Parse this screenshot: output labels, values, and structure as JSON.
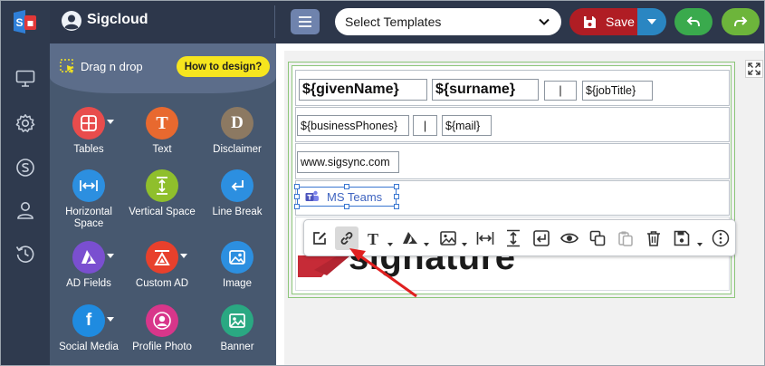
{
  "app": {
    "name": "Sigcloud"
  },
  "header": {
    "template_select": {
      "value": "Select Templates"
    },
    "save_label": "Save"
  },
  "panel": {
    "title": "Drag n drop",
    "help_button": "How to design?",
    "tools": [
      {
        "key": "tables",
        "label": "Tables",
        "color": "#e84c4c",
        "icon": "table-icon",
        "caret": true
      },
      {
        "key": "text",
        "label": "Text",
        "color": "#e8692f",
        "icon": "text-icon",
        "glyph": "T"
      },
      {
        "key": "disclaimer",
        "label": "Disclaimer",
        "color": "#8c7962",
        "icon": "disclaimer-icon",
        "glyph": "D"
      },
      {
        "key": "horizontal-space",
        "label": "Horizontal Space",
        "color": "#2c8fe0",
        "icon": "horizontal-space-icon"
      },
      {
        "key": "vertical-space",
        "label": "Vertical Space",
        "color": "#8fbf2c",
        "icon": "vertical-space-icon"
      },
      {
        "key": "line-break",
        "label": "Line Break",
        "color": "#2c8fe0",
        "icon": "line-break-icon"
      },
      {
        "key": "ad-fields",
        "label": "AD Fields",
        "color": "#7a4fd0",
        "icon": "azure-icon",
        "caret": true
      },
      {
        "key": "custom-ad",
        "label": "Custom AD",
        "color": "#e8402c",
        "icon": "custom-ad-icon",
        "caret": true
      },
      {
        "key": "image",
        "label": "Image",
        "color": "#2c8fe0",
        "icon": "image-icon"
      },
      {
        "key": "social-media",
        "label": "Social Media",
        "color": "#1f8be0",
        "icon": "facebook-icon",
        "glyph": "f",
        "caret": true
      },
      {
        "key": "profile-photo",
        "label": "Profile Photo",
        "color": "#d8368a",
        "icon": "profile-photo-icon"
      },
      {
        "key": "banner",
        "label": "Banner",
        "color": "#2aa882",
        "icon": "banner-icon"
      }
    ]
  },
  "signature": {
    "given_name": "${givenName}",
    "surname": "${surname}",
    "pipe1": "|",
    "job_title": "${jobTitle}",
    "business_phones": "${businessPhones}",
    "pipe2": "|",
    "mail": "${mail}",
    "website": "www.sigsync.com",
    "teams_label": "MS Teams",
    "logo_text": "signature"
  },
  "colors": {
    "header_bg": "#2d374b",
    "panel_bg": "#47586f",
    "save": "#b01d24",
    "save_dropdown": "#2a86c2",
    "undo": "#3aaa4d",
    "redo": "#6db53b",
    "help_button": "#f6e51e",
    "selection": "#3977d1",
    "annotation_arrow": "#e02020"
  }
}
